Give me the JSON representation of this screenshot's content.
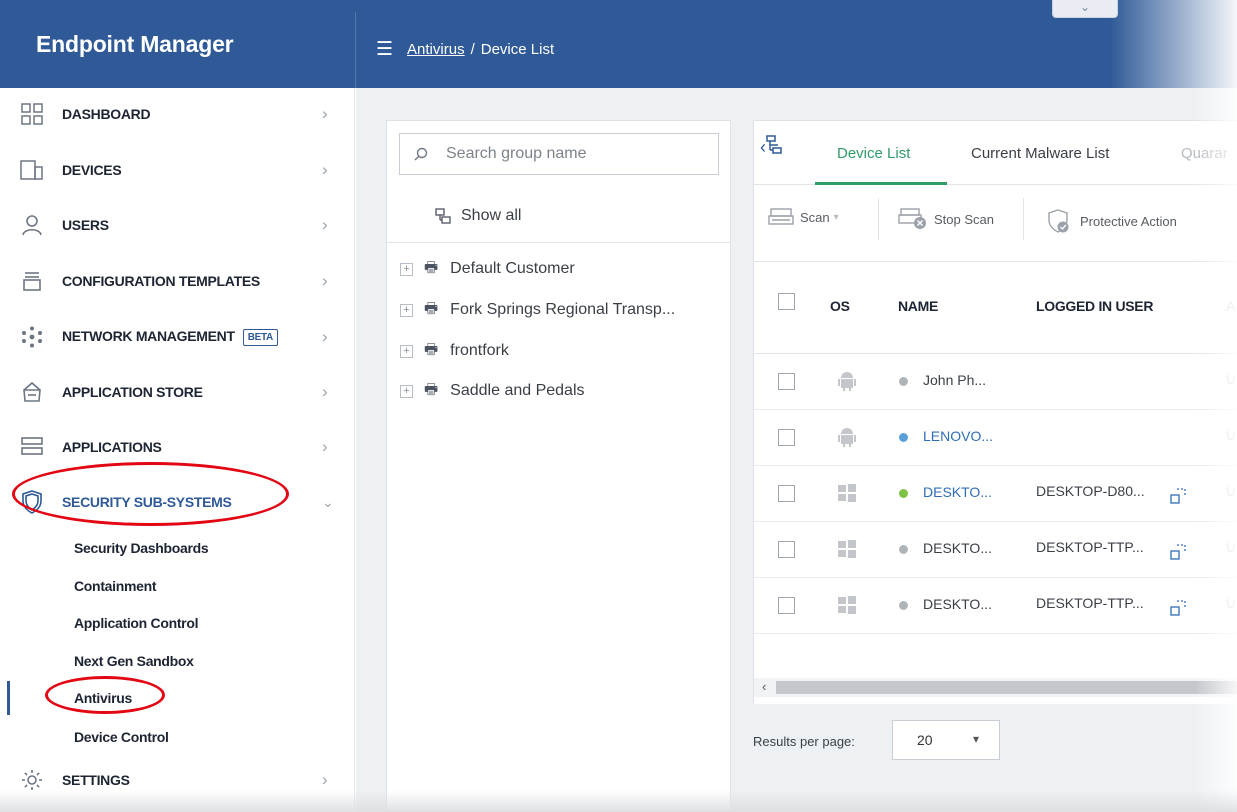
{
  "app": {
    "title": "Endpoint Manager"
  },
  "breadcrumb": {
    "parent": "Antivirus",
    "separator": "/",
    "current": "Device List"
  },
  "header": {
    "collapse_glyph": "⌄"
  },
  "sidebar": {
    "items": [
      {
        "label": "DASHBOARD",
        "icon": "dashboard-icon"
      },
      {
        "label": "DEVICES",
        "icon": "devices-icon"
      },
      {
        "label": "USERS",
        "icon": "user-icon"
      },
      {
        "label": "CONFIGURATION TEMPLATES",
        "icon": "templates-icon"
      },
      {
        "label": "NETWORK MANAGEMENT",
        "icon": "network-icon",
        "badge": "BETA"
      },
      {
        "label": "APPLICATION STORE",
        "icon": "store-icon"
      },
      {
        "label": "APPLICATIONS",
        "icon": "applications-icon"
      },
      {
        "label": "SECURITY SUB-SYSTEMS",
        "icon": "shield-icon",
        "expanded": true
      },
      {
        "label": "SETTINGS",
        "icon": "gear-icon"
      }
    ],
    "security_subitems": [
      "Security Dashboards",
      "Containment",
      "Application Control",
      "Next Gen Sandbox",
      "Antivirus",
      "Device Control"
    ],
    "active_subitem": "Antivirus"
  },
  "groups": {
    "search_placeholder": "Search group name",
    "show_all": "Show all",
    "items": [
      "Default Customer",
      "Fork Springs Regional Transp...",
      "frontfork",
      "Saddle and Pedals"
    ]
  },
  "tabs": [
    "Device List",
    "Current Malware List",
    "Quarar"
  ],
  "active_tab": "Device List",
  "toolbar": {
    "scan": "Scan",
    "stop_scan": "Stop Scan",
    "protective_action": "Protective Action"
  },
  "table": {
    "columns": [
      "OS",
      "NAME",
      "LOGGED IN USER",
      "A"
    ],
    "rows": [
      {
        "os": "android",
        "status": "#b0b4ba",
        "name": "John Ph...",
        "link": false,
        "user": "",
        "tail": "U"
      },
      {
        "os": "android",
        "status": "#5aa0d8",
        "name": "LENOVO...",
        "link": true,
        "user": "",
        "tail": "U"
      },
      {
        "os": "windows",
        "status": "#7cc243",
        "name": "DESKTO...",
        "link": true,
        "user": "DESKTOP-D80...",
        "tail": "U"
      },
      {
        "os": "windows",
        "status": "#b0b4ba",
        "name": "DESKTO...",
        "link": false,
        "user": "DESKTOP-TTP...",
        "tail": "U"
      },
      {
        "os": "windows",
        "status": "#b0b4ba",
        "name": "DESKTO...",
        "link": false,
        "user": "DESKTOP-TTP...",
        "tail": "U"
      }
    ]
  },
  "pagination": {
    "label": "Results per page:",
    "value": "20"
  },
  "colors": {
    "header": "#2f5a97",
    "active_tab": "#2f9c6a",
    "highlight": "#e30613"
  }
}
